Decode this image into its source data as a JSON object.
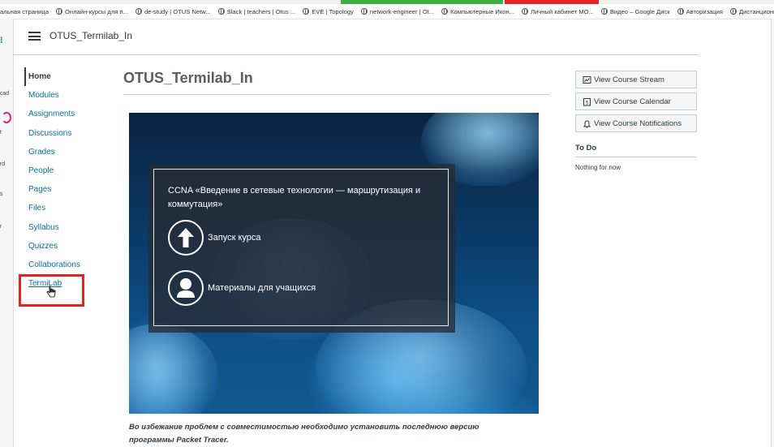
{
  "bookmarks": [
    {
      "label": "альная страница",
      "icon": "none"
    },
    {
      "label": "Онлайн-курсы для п...",
      "icon": "globe-icon"
    },
    {
      "label": "de-study | OTUS Netw...",
      "icon": "globe-icon"
    },
    {
      "label": "Slack | teachers | Otus ...",
      "icon": "globe-icon"
    },
    {
      "label": "EVE | Topology",
      "icon": "globe-icon"
    },
    {
      "label": "network-engineer | Ot...",
      "icon": "globe-icon"
    },
    {
      "label": "Компьютерные Икон...",
      "icon": "globe-icon"
    },
    {
      "label": "Личный кабинет МО...",
      "icon": "globe-icon"
    },
    {
      "label": "Видео – Google Диск",
      "icon": "globe-icon"
    },
    {
      "label": "Авторизация",
      "icon": "globe-icon"
    },
    {
      "label": "Дистанционно",
      "icon": "globe-icon"
    }
  ],
  "global_nav": [
    "acad",
    "nt",
    "ard",
    "es",
    "ar"
  ],
  "header": {
    "breadcrumb": "OTUS_Termilab_In"
  },
  "course_nav": [
    {
      "label": "Home",
      "active": true
    },
    {
      "label": "Modules"
    },
    {
      "label": "Assignments"
    },
    {
      "label": "Discussions"
    },
    {
      "label": "Grades"
    },
    {
      "label": "People"
    },
    {
      "label": "Pages"
    },
    {
      "label": "Files"
    },
    {
      "label": "Syllabus"
    },
    {
      "label": "Quizzes"
    },
    {
      "label": "Collaborations"
    },
    {
      "label": "TermiLab",
      "highlighted": true
    }
  ],
  "main": {
    "title": "OTUS_Termilab_In",
    "hero": {
      "heading": "CCNA «Введение в сетевые технологии — маршрутизация и коммутация»",
      "link1": "Запуск курса",
      "link2": "Материалы для учащихся"
    },
    "notice": "Во избежание проблем с совместимостью необходимо установить последнюю версию программы Packet Tracer."
  },
  "sidebar": {
    "buttons": [
      {
        "label": "View Course Stream",
        "icon": "stream-icon"
      },
      {
        "label": "View Course Calendar",
        "icon": "calendar-icon"
      },
      {
        "label": "View Course Notifications",
        "icon": "bell-icon"
      }
    ],
    "todo_title": "To Do",
    "todo_empty": "Nothing for now"
  },
  "colors": {
    "link": "#0770a3",
    "highlight": "#e32222",
    "text": "#2d3b45"
  }
}
